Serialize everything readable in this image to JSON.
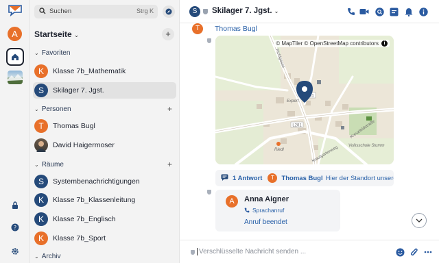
{
  "search": {
    "placeholder": "Suchen",
    "shortcut": "Strg K"
  },
  "rail": {
    "user_initial": "A"
  },
  "home": {
    "title": "Startseite"
  },
  "sections": {
    "favorites": "Favoriten",
    "people": "Personen",
    "rooms": "Räume",
    "archive": "Archiv"
  },
  "favorites": [
    {
      "initial": "K",
      "name": "Klasse 7b_Mathematik",
      "color": "orange"
    },
    {
      "initial": "S",
      "name": "Skilager 7. Jgst.",
      "color": "blue",
      "selected": true
    }
  ],
  "people": [
    {
      "initial": "T",
      "name": "Thomas Bugl",
      "color": "orange"
    },
    {
      "initial": "",
      "name": "David Haigermoser",
      "color": "photo"
    }
  ],
  "rooms": [
    {
      "initial": "S",
      "name": "Systembenachrichtigungen",
      "color": "blue"
    },
    {
      "initial": "K",
      "name": "Klasse 7b_Klassenleitung",
      "color": "blue"
    },
    {
      "initial": "K",
      "name": "Klasse 7b_Englisch",
      "color": "blue"
    },
    {
      "initial": "K",
      "name": "Klasse 7b_Sport",
      "color": "orange"
    }
  ],
  "header": {
    "initial": "S",
    "title": "Skilager 7. Jgst."
  },
  "timeline": {
    "sender_initial": "T",
    "sender_name": "Thomas Bugl",
    "map_attribution": "© MapTiler © OpenStreetMap contributors",
    "map_labels": {
      "road1": "L281",
      "road2": "L281",
      "street1": "Kreuzfeldstraße",
      "street2": "Pichlgasse",
      "place1": "Expert",
      "place2": "Volksschule Stumm",
      "place3": "Riedl",
      "street3": "Krautgartenweg"
    },
    "thread": {
      "count": "1 Antwort",
      "author_initial": "T",
      "author": "Thomas Bugl",
      "preview": "Hier der Standort unserer ..."
    },
    "call": {
      "initial": "A",
      "name": "Anna Aigner",
      "type": "Sprachanruf",
      "status": "Anruf beendet"
    }
  },
  "composer": {
    "placeholder": "Verschlüsselte Nachricht senden ..."
  },
  "colors": {
    "accent": "#2860a8",
    "orange": "#e8702a",
    "navy": "#254a7a"
  }
}
